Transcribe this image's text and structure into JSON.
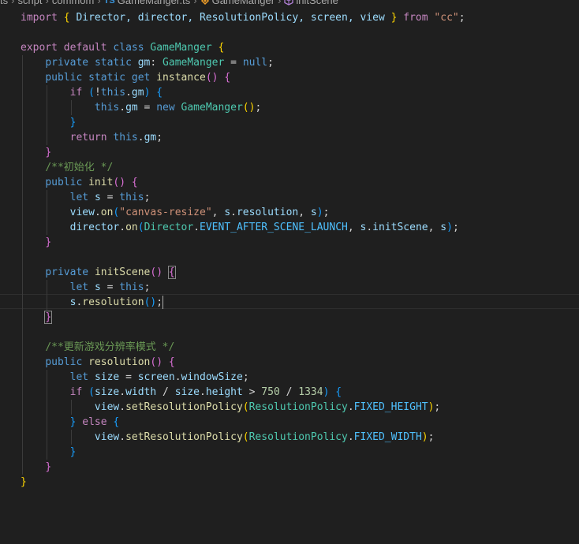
{
  "breadcrumb": {
    "items": [
      "ts",
      "script",
      "commom",
      "GameManger.ts",
      "GameManger",
      "initScene"
    ],
    "ts_badge": "TS"
  },
  "code": {
    "l1": [
      "import",
      " ",
      "{",
      " Director, director, ResolutionPolicy, screen, view ",
      "}",
      " ",
      "from",
      " ",
      "\"cc\"",
      ";"
    ],
    "l3": [
      "export",
      " ",
      "default",
      " ",
      "class",
      " ",
      "GameManger",
      " ",
      "{"
    ],
    "l4": [
      "private",
      " ",
      "static",
      " ",
      "gm",
      ": ",
      "GameManger",
      " = ",
      "null",
      ";"
    ],
    "l5": [
      "public",
      " ",
      "static",
      " ",
      "get",
      " ",
      "instance",
      "()",
      " ",
      "{"
    ],
    "l6": [
      "if",
      " ",
      "(",
      "!",
      "this",
      ".",
      "gm",
      ")",
      " ",
      "{"
    ],
    "l7": [
      "this",
      ".",
      "gm",
      " = ",
      "new",
      " ",
      "GameManger",
      "()",
      ";"
    ],
    "l8": [
      "}"
    ],
    "l9": [
      "return",
      " ",
      "this",
      ".",
      "gm",
      ";"
    ],
    "l10": [
      "}"
    ],
    "l11": [
      "/**初始化 */"
    ],
    "l12": [
      "public",
      " ",
      "init",
      "()",
      " ",
      "{"
    ],
    "l13": [
      "let",
      " ",
      "s",
      " = ",
      "this",
      ";"
    ],
    "l14": [
      "view",
      ".",
      "on",
      "(",
      "\"canvas-resize\"",
      ", ",
      "s",
      ".",
      "resolution",
      ", ",
      "s",
      ")",
      ";"
    ],
    "l15": [
      "director",
      ".",
      "on",
      "(",
      "Director",
      ".",
      "EVENT_AFTER_SCENE_LAUNCH",
      ", ",
      "s",
      ".",
      "initScene",
      ", ",
      "s",
      ")",
      ";"
    ],
    "l16": [
      "}"
    ],
    "l18": [
      "private",
      " ",
      "initScene",
      "()",
      " ",
      "{"
    ],
    "l19": [
      "let",
      " ",
      "s",
      " = ",
      "this",
      ";"
    ],
    "l20": [
      "s",
      ".",
      "resolution",
      "()",
      ";"
    ],
    "l21": [
      "}"
    ],
    "l23": [
      "/**更新游戏分辨率模式 */"
    ],
    "l24": [
      "public",
      " ",
      "resolution",
      "()",
      " ",
      "{"
    ],
    "l25": [
      "let",
      " ",
      "size",
      " = ",
      "screen",
      ".",
      "windowSize",
      ";"
    ],
    "l26": [
      "if",
      " ",
      "(",
      "size",
      ".",
      "width",
      " / ",
      "size",
      ".",
      "height",
      " > ",
      "750",
      " / ",
      "1334",
      ")",
      " ",
      "{"
    ],
    "l27": [
      "view",
      ".",
      "setResolutionPolicy",
      "(",
      "ResolutionPolicy",
      ".",
      "FIXED_HEIGHT",
      ")",
      ";"
    ],
    "l28": [
      "}",
      " ",
      "else",
      " ",
      "{"
    ],
    "l29": [
      "view",
      ".",
      "setResolutionPolicy",
      "(",
      "ResolutionPolicy",
      ".",
      "FIXED_WIDTH",
      ")",
      ";"
    ],
    "l30": [
      "}"
    ],
    "l31": [
      "}"
    ],
    "l32": [
      "}"
    ]
  },
  "colors": {
    "background": "#1f1f1f",
    "keyword": "#569cd6",
    "control": "#c586c0",
    "type": "#4ec9b0",
    "function": "#dcdcaa",
    "string": "#ce9178",
    "comment": "#6a9955"
  }
}
